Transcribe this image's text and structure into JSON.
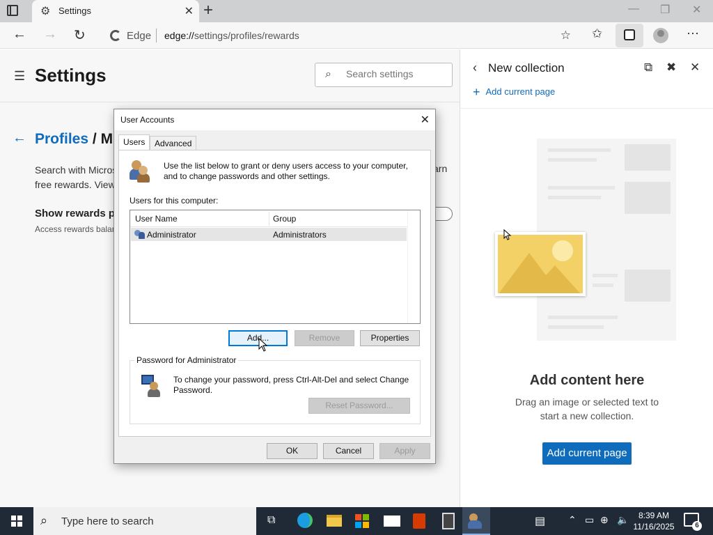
{
  "browser": {
    "tab_title": "Settings",
    "address_prefix": "Edge",
    "url_domain": "edge://",
    "url_path": "settings/profiles/rewards"
  },
  "settings": {
    "heading": "Settings",
    "search_placeholder": "Search settings",
    "breadcrumb_link": "Profiles",
    "breadcrumb_separator": "/",
    "breadcrumb_current": "Mi",
    "description_line1": "Search with Micros",
    "description_line2": "free rewards. View",
    "description_right": "arn",
    "show_rewards_title": "Show rewards poi",
    "access_text": "Access rewards balan"
  },
  "collections": {
    "title": "New collection",
    "add_current_page_link": "Add current page",
    "empty_title": "Add content here",
    "empty_text": "Drag an image or selected text to start a new collection.",
    "add_current_page_button": "Add current page"
  },
  "dialog": {
    "title": "User Accounts",
    "tabs": [
      "Users",
      "Advanced"
    ],
    "intro": "Use the list below to grant or deny users access to your computer, and to change passwords and other settings.",
    "users_label": "Users for this computer:",
    "columns": [
      "User Name",
      "Group"
    ],
    "rows": [
      {
        "user": "Administrator",
        "group": "Administrators"
      }
    ],
    "add_button": "Add...",
    "remove_button": "Remove",
    "properties_button": "Properties",
    "password_group_label": "Password for Administrator",
    "password_text": "To change your password, press Ctrl-Alt-Del and select Change Password.",
    "reset_password_button": "Reset Password...",
    "ok_button": "OK",
    "cancel_button": "Cancel",
    "apply_button": "Apply"
  },
  "taskbar": {
    "search_placeholder": "Type here to search",
    "time": "8:39 AM",
    "date": "11/16/2025",
    "notification_count": "6"
  },
  "colors": {
    "accent": "#0f6cbd",
    "taskbar": "#1f2a36",
    "dialog_focus": "#0078d7"
  }
}
